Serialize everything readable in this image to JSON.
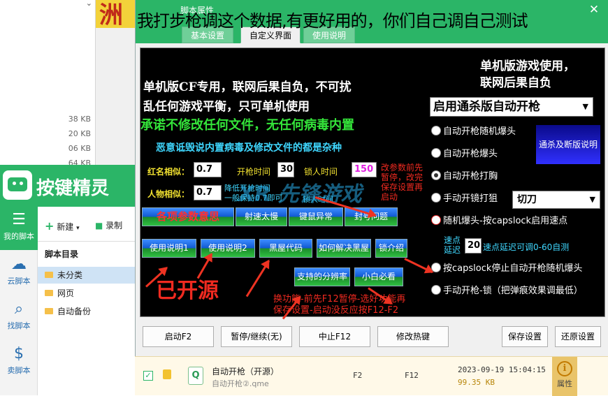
{
  "explorer": {
    "sizes": [
      "38 KB",
      "20 KB",
      "06 KB",
      "64 KB"
    ]
  },
  "banner_fragment": "洲",
  "app": {
    "brand": "按键精灵",
    "toolbar": {
      "new_label": "新建",
      "record_label": "录制"
    },
    "nav": [
      {
        "label": "我的脚本",
        "icon": "list-icon"
      },
      {
        "label": "云脚本",
        "icon": "cloud-icon"
      },
      {
        "label": "找脚本",
        "icon": "search-icon"
      },
      {
        "label": "卖脚本",
        "icon": "dollar-icon"
      }
    ],
    "tree": {
      "title": "脚本目录",
      "items": [
        "未分类",
        "网页",
        "自动备份"
      ]
    }
  },
  "dialog": {
    "title": "脚本属性",
    "overlay_caption": "我打步枪调这个数据,有更好用的，你们自己调自己测试",
    "tabs": [
      "基本设置",
      "自定义界面",
      "使用说明"
    ],
    "panel": {
      "top_right_notice": [
        "单机版游戏使用，",
        "联网后果自负"
      ],
      "notice_lines": [
        "单机版CF专用，联网后果自负，不可扰",
        "乱任何游戏平衡，只可单机使用"
      ],
      "promise": "承诺不修改任何文件，无任何病毒内置",
      "warning": "恶意诋毁说内置病毒及修改文件的都是杂种",
      "mode_select": "启用通杀版自动开枪",
      "fields": {
        "red_name_label": "红名相似：",
        "red_name_value": "0.7",
        "fire_time_label": "开枪时间",
        "fire_time_value": "30",
        "lock_time_label": "锁人时间",
        "lock_time_value": "150",
        "person_label": "人物相似：",
        "person_value": "0.7",
        "fire_hint": [
          "降低开枪时间",
          "一般保持0.7即可"
        ],
        "lock_hint": [
          "",
          "锁人时间"
        ],
        "param_note": [
          "改参数前先",
          "暂停，改完",
          "保存设置再",
          "启动"
        ]
      },
      "buttons_row1": [
        "各项参数意思",
        "射速太慢",
        "键鼠异常",
        "封号问题"
      ],
      "buttons_row2": [
        "使用说明1",
        "使用说明2",
        "黑屋代码",
        "如何解决黑屋",
        "锁介绍"
      ],
      "buttons_row3": [
        "支持的分辨率",
        "小白必看"
      ],
      "radios": [
        {
          "label": "自动开枪随机爆头",
          "on": false
        },
        {
          "label": "自动开枪爆头",
          "on": false
        },
        {
          "label": "自动开枪打胸",
          "on": true
        },
        {
          "label": "手动开镜打狙",
          "on": false
        },
        {
          "label": "随机爆头-按capslock启用速点",
          "on": false
        },
        {
          "label": "按capslock停止自动开枪随机爆头",
          "on": false
        },
        {
          "label": "手动开枪-锁（把弹痕效果调最低）",
          "on": false
        }
      ],
      "blue_button": "通杀及断版说明",
      "knife_select": "切刀",
      "speed": {
        "label": [
          "速点",
          "延迟"
        ],
        "value": "20",
        "hint": "速点延迟可调0-60自测"
      },
      "open_source": "已开源",
      "bottom_note": [
        "换功能-前先F12暂停-选好功能再",
        "保存设置-启动没反应按F12-F2"
      ],
      "watermark": "XR 先锋游戏"
    },
    "bottom_buttons": [
      "启动F2",
      "暂停/继续(无)",
      "中止F12",
      "修改热键",
      "保存设置",
      "还原设置"
    ]
  },
  "script_row": {
    "name": "自动开枪（开源）",
    "file": "自动开枪②.qme",
    "start_key": "F2",
    "stop_key": "F12",
    "datetime": "2023-09-19 15:04:15",
    "size": "99.35 KB",
    "prop_label": "属性"
  }
}
